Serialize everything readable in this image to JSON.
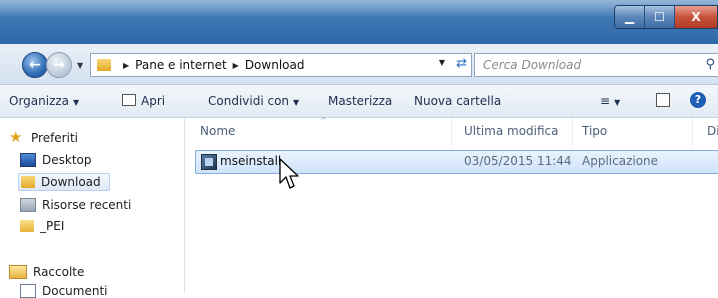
{
  "window": {
    "controls": {
      "minimize": "▁",
      "maximize": "☐",
      "close": "X"
    }
  },
  "nav": {
    "breadcrumbs": [
      "Pane e internet",
      "Download"
    ],
    "search_placeholder": "Cerca Download"
  },
  "toolbar": {
    "organize": "Organizza",
    "open": "Apri",
    "share": "Condividi con",
    "burn": "Masterizza",
    "new_folder": "Nuova cartella"
  },
  "sidebar": {
    "favorites": "Preferiti",
    "items": [
      "Desktop",
      "Download",
      "Risorse recenti",
      "_PEI"
    ],
    "libraries": "Raccolte",
    "library_items": [
      "Documenti"
    ]
  },
  "columns": [
    "Nome",
    "Ultima modifica",
    "Tipo",
    "Di"
  ],
  "files": [
    {
      "name": "mseinstall",
      "modified": "03/05/2015 11:44",
      "type": "Applicazione"
    }
  ],
  "colors": {
    "accent": "#3f78b5",
    "selection": "#cfe3fb"
  }
}
